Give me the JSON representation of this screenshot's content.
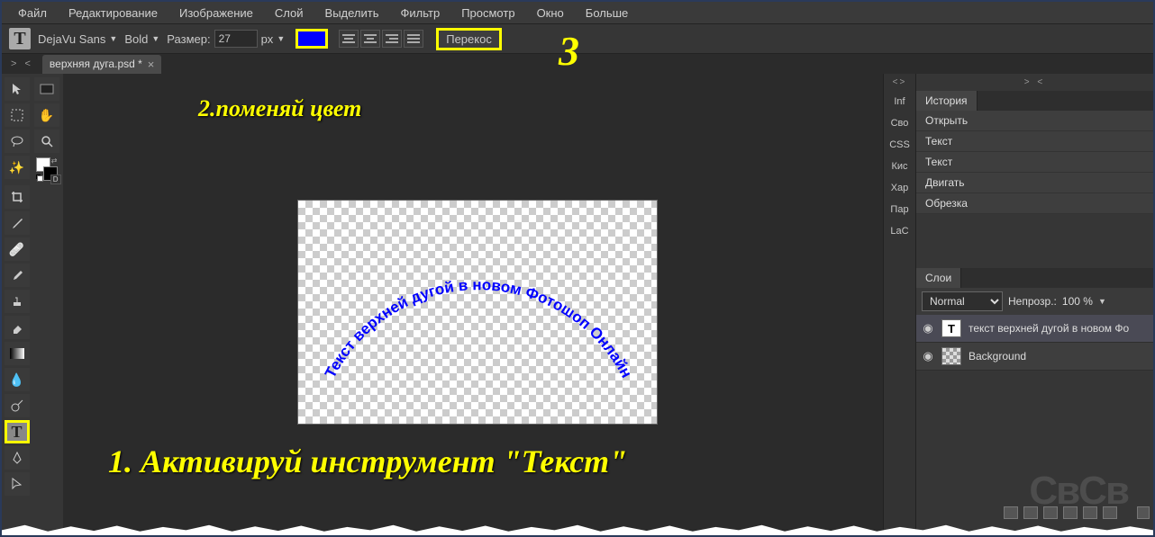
{
  "menubar": [
    "Файл",
    "Редактирование",
    "Изображение",
    "Слой",
    "Выделить",
    "Фильтр",
    "Просмотр",
    "Окно",
    "Больше"
  ],
  "toolbar": {
    "font": "DejaVu Sans",
    "weight": "Bold",
    "size_label": "Размер:",
    "size_value": "27",
    "size_unit": "px",
    "warp_label": "Перекос",
    "color": "#0000ff"
  },
  "file_tab": {
    "name": "верхняя дуга.psd *"
  },
  "annotations": {
    "step1": "1. Активируй инструмент \"Текст\"",
    "step2": "2.поменяй цвет",
    "step3": "3"
  },
  "canvas_text": "Текст верхней дугой в новом Фотошоп Онлайн",
  "mini_tabs": [
    "Inf",
    "Сво",
    "CSS",
    "Кис",
    "Хар",
    "Пар",
    "LaC"
  ],
  "history": {
    "tab": "История",
    "items": [
      "Открыть",
      "Текст",
      "Текст",
      "Двигать",
      "Обрезка"
    ]
  },
  "layers": {
    "tab": "Слои",
    "blend": "Normal",
    "opacity_label": "Непрозр.:",
    "opacity_value": "100 %",
    "items": [
      {
        "type": "T",
        "name": "текст верхней дугой в новом Фо"
      },
      {
        "type": "bg",
        "name": "Background"
      }
    ]
  },
  "watermark": "CвCв",
  "arrows": "> <"
}
